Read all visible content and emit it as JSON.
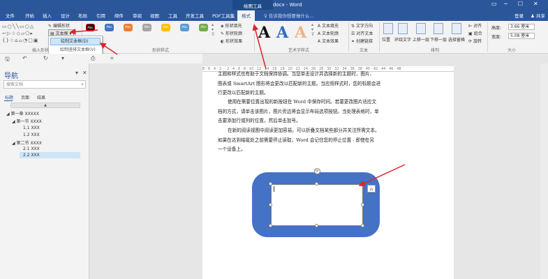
{
  "title_bar": {
    "title": "Word教程2.docx - Word",
    "context_tab": "绘图工具",
    "window_controls": [
      "▭",
      "─",
      "☐",
      "✕"
    ]
  },
  "tabs": [
    "文件",
    "开始",
    "插入",
    "设计",
    "布局",
    "引用",
    "邮件",
    "审阅",
    "视图",
    "工具",
    "开发工具",
    "PDF工具集",
    "格式"
  ],
  "tell_me": "告诉我你想要做什么...",
  "login": "登录",
  "share": "共享",
  "ribbon": {
    "insert_shapes": {
      "edit_shape": "编辑形状",
      "textbox": "文本框",
      "label": "插入形状"
    },
    "dropdown": {
      "draw_textbox": "绘制文本框(D)",
      "draw_vertical_textbox": "绘制竖排文本框(V)"
    },
    "shape_styles": {
      "samples": [
        "Abc",
        "Abc",
        "Abc",
        "Abc",
        "Abc",
        "Abc",
        "Abc"
      ],
      "colors": [
        "#111111",
        "#4472c4",
        "#ed7d31",
        "#a5a5a5",
        "#ffc000",
        "#5b9bd5",
        "#70ad47"
      ],
      "fill": "形状填充",
      "outline": "形状轮廓",
      "effect": "形状效果",
      "label": "形状样式"
    },
    "wordart": {
      "letters": [
        "A",
        "A",
        "A"
      ],
      "letter_colors": [
        "#111111",
        "#2e6bc6",
        "#f4b183"
      ],
      "text_fill": "文本填充",
      "text_outline": "文本轮廓",
      "text_effect": "文本效果",
      "label": "艺术字样式"
    },
    "text": {
      "direction": "文字方向",
      "align": "对齐文本",
      "link": "创建链接",
      "label": "文本"
    },
    "arrange": {
      "position": "位置",
      "wrap": "环绕文字",
      "forward": "上移一层",
      "backward": "下移一层",
      "pane": "选择窗格",
      "align": "对齐",
      "group": "组合",
      "rotate": "旋转",
      "label": "排列"
    },
    "size": {
      "height_label": "高度:",
      "height": "3.66 厘米",
      "width_label": "宽度:",
      "width": "5.08 厘米",
      "label": "大小"
    }
  },
  "nav": {
    "title": "导航",
    "search_placeholder": "搜索文档",
    "tabs": [
      "标题",
      "页面",
      "结果"
    ],
    "collapse": "▲",
    "headings": [
      "第一章 XXXXX",
      "第一节 XXXX",
      "1.1 XXX",
      "1.2 XXX",
      "第二节 XXXX",
      "2.1 XXX",
      "2.2 XXX"
    ]
  },
  "ruler": "8 · 6 · 4 · 2 · · 2 · 4 · 6 · 8 · 10 · 12 · 14 · 16 · 18 · 20 · 22 · 24 · 26 · 28 · 30 · 32 · 34 · 36 · 38 · 40 · 42 · 44 · 46 · 48",
  "document": {
    "lines": [
      "主题和样式也有助于文档保持协调。当您单击设计并选择新的主题时，图片、",
      "图表或 SmartArt 图形将会更改以匹配新的主题。当应用样式时，您的标题会进",
      "行更改以匹配新的主题。",
      "使用在需要位置出现的新按钮在 Word 中保存时间。若要更改图片适应文",
      "档的方式，请单击该图片，图片旁边将会显示布局选项按钮。当处理表格时，单",
      "击要添加行或列的位置，然后单击加号。",
      "在新的阅读视图中阅读更加容易。可以折叠文档某些部分并关注所需文本。",
      "如果在达到结尾处之前需要停止读取，Word 会记住您的停止位置 - 即使在另",
      "一个设备上。"
    ]
  }
}
